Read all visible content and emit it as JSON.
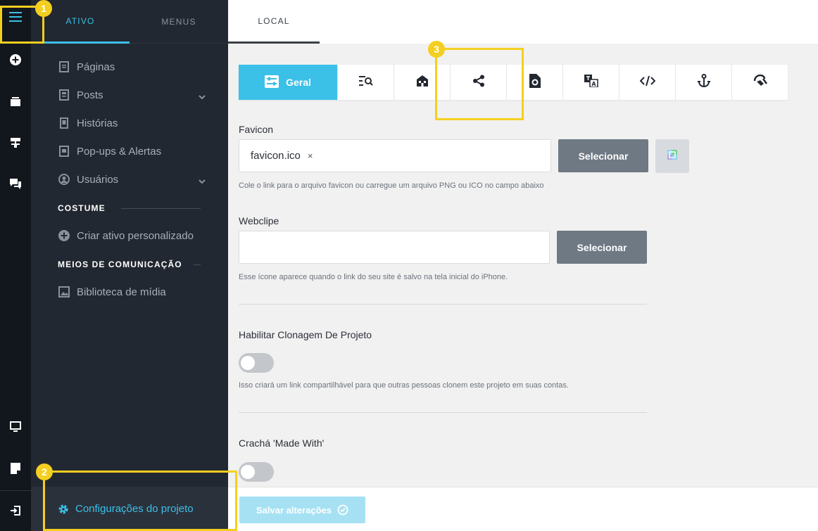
{
  "sidebar": {
    "tabs": [
      {
        "label": "ATIVO"
      },
      {
        "label": "MENUS"
      }
    ],
    "items": [
      {
        "label": "Páginas",
        "icon": "pages-icon"
      },
      {
        "label": "Posts",
        "icon": "posts-icon"
      },
      {
        "label": "Histórias",
        "icon": "stories-icon"
      },
      {
        "label": "Pop-ups & Alertas",
        "icon": "popups-icon"
      },
      {
        "label": "Usuários",
        "icon": "user-icon"
      }
    ],
    "custom_section": "COSTUME",
    "custom_item": "Criar ativo personalizado",
    "media_section": "MEIOS DE COMUNICAÇÃO",
    "media_item": "Biblioteca de mídia",
    "footer": "Configurações do projeto"
  },
  "topbar": {
    "tab": "LOCAL"
  },
  "settings_tabs": {
    "active_label": "Geral",
    "icons": [
      "general-sliders-icon",
      "seo-search-icon",
      "store-icon",
      "share-icon",
      "document-gear-icon",
      "translate-icon",
      "code-icon",
      "anchor-icon",
      "bug-icon"
    ]
  },
  "favicon": {
    "label": "Favicon",
    "value": "favicon.ico",
    "clear": "×",
    "button": "Selecionar",
    "help": "Cole o link para o arquivo favicon ou carregue um arquivo PNG ou ICO no campo abaixo"
  },
  "webclip": {
    "label": "Webclipe",
    "value": "",
    "button": "Selecionar",
    "help": "Esse ícone aparece quando o link do seu site é salvo na tela inicial do iPhone."
  },
  "cloning": {
    "label": "Habilitar Clonagem De Projeto",
    "enabled": false,
    "help": "Isso criará um link compartilhável para que outras pessoas clonem este projeto em suas contas."
  },
  "badge_made_with": {
    "label": "Crachá 'Made With'",
    "enabled": false
  },
  "save": {
    "label": "Salvar alterações"
  },
  "callouts": [
    "1",
    "2",
    "3"
  ],
  "colors": {
    "accent": "#3bc0e8",
    "callout": "#f5cf1f",
    "rail": "#12161d",
    "sidebar": "#222831"
  }
}
